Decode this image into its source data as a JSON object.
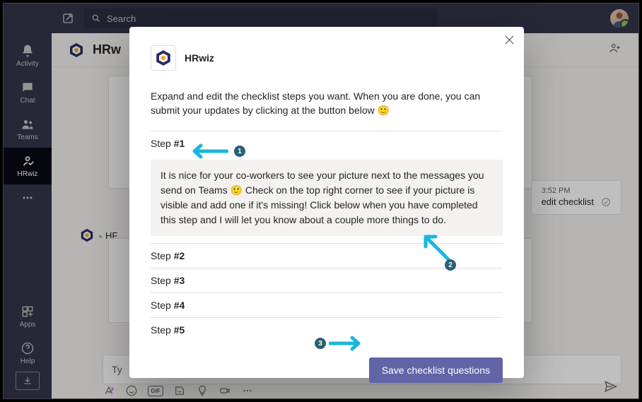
{
  "topbar": {
    "search_placeholder": "Search"
  },
  "rail": {
    "items": [
      {
        "key": "activity",
        "label": "Activity"
      },
      {
        "key": "chat",
        "label": "Chat"
      },
      {
        "key": "teams",
        "label": "Teams"
      },
      {
        "key": "hrwiz",
        "label": "HRwiz"
      },
      {
        "key": "more",
        "label": ""
      }
    ],
    "footer": [
      {
        "key": "apps",
        "label": "Apps"
      },
      {
        "key": "help",
        "label": "Help"
      }
    ]
  },
  "chat_header": {
    "title": "HRw"
  },
  "background": {
    "author_initials": "HF",
    "pill_time": "3:52 PM",
    "pill_label": "edit checklist",
    "compose_placeholder": "Ty"
  },
  "modal": {
    "app_name": "HRwiz",
    "intro": "Expand and edit the checklist steps you want. When you are done, you can submit your updates by clicking at the button below 🙂",
    "steps": [
      {
        "label_prefix": "Step ",
        "label_num": "#1",
        "body": "It is nice for your co-workers to see your picture next to the messages you send on Teams 🙂 Check on the top right corner to see if your picture is visible and add one if it's missing! Click below when you have completed this step and I will let you know about a couple more things to do."
      },
      {
        "label_prefix": "Step ",
        "label_num": "#2"
      },
      {
        "label_prefix": "Step ",
        "label_num": "#3"
      },
      {
        "label_prefix": "Step ",
        "label_num": "#4"
      },
      {
        "label_prefix": "Step ",
        "label_num": "#5"
      }
    ],
    "save_label": "Save checklist questions"
  },
  "annotations": {
    "b1": "1",
    "b2": "2",
    "b3": "3"
  }
}
